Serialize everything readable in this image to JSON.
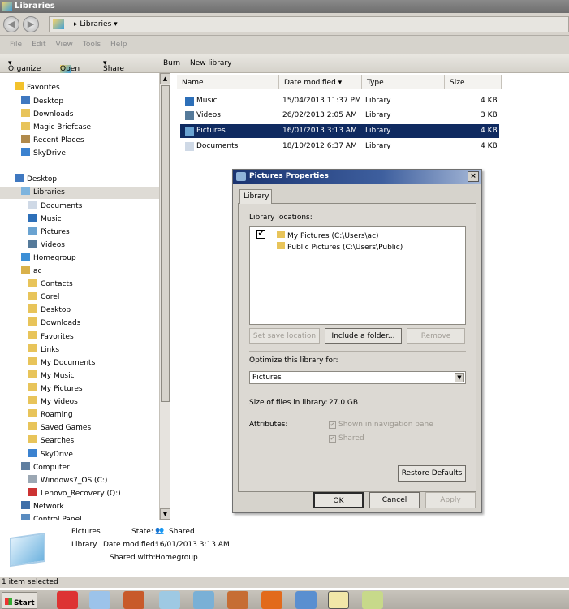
{
  "window": {
    "title": "Libraries"
  },
  "address": {
    "path": "Libraries"
  },
  "menu": [
    "File",
    "Edit",
    "View",
    "Tools",
    "Help"
  ],
  "toolbar": {
    "organize": "Organize",
    "open": "Open",
    "share_with": "Share with",
    "burn": "Burn",
    "new_library": "New library"
  },
  "nav": [
    {
      "label": "Favorites",
      "level": 0,
      "icon": "star-icon"
    },
    {
      "label": "Desktop",
      "level": 1,
      "icon": "desktop-icon"
    },
    {
      "label": "Downloads",
      "level": 1,
      "icon": "folder-icon"
    },
    {
      "label": "Magic Briefcase",
      "level": 1,
      "icon": "folder-icon"
    },
    {
      "label": "Recent Places",
      "level": 1,
      "icon": "recent-places-icon"
    },
    {
      "label": "SkyDrive",
      "level": 1,
      "icon": "skydrive-icon"
    },
    {
      "label": "Desktop",
      "level": 0,
      "icon": "desktop-icon"
    },
    {
      "label": "Libraries",
      "level": 1,
      "icon": "libraries-icon",
      "selected": true
    },
    {
      "label": "Documents",
      "level": 2,
      "icon": "documents-icon"
    },
    {
      "label": "Music",
      "level": 2,
      "icon": "music-icon"
    },
    {
      "label": "Pictures",
      "level": 2,
      "icon": "pictures-icon"
    },
    {
      "label": "Videos",
      "level": 2,
      "icon": "videos-icon"
    },
    {
      "label": "Homegroup",
      "level": 1,
      "icon": "homegroup-icon"
    },
    {
      "label": "ac",
      "level": 1,
      "icon": "user-folder-icon"
    },
    {
      "label": "Contacts",
      "level": 2,
      "icon": "folder-icon"
    },
    {
      "label": "Corel",
      "level": 2,
      "icon": "folder-icon"
    },
    {
      "label": "Desktop",
      "level": 2,
      "icon": "folder-icon"
    },
    {
      "label": "Downloads",
      "level": 2,
      "icon": "folder-icon"
    },
    {
      "label": "Favorites",
      "level": 2,
      "icon": "folder-icon"
    },
    {
      "label": "Links",
      "level": 2,
      "icon": "folder-icon"
    },
    {
      "label": "My Documents",
      "level": 2,
      "icon": "folder-icon"
    },
    {
      "label": "My Music",
      "level": 2,
      "icon": "folder-icon"
    },
    {
      "label": "My Pictures",
      "level": 2,
      "icon": "folder-icon"
    },
    {
      "label": "My Videos",
      "level": 2,
      "icon": "folder-icon"
    },
    {
      "label": "Roaming",
      "level": 2,
      "icon": "folder-icon"
    },
    {
      "label": "Saved Games",
      "level": 2,
      "icon": "folder-icon"
    },
    {
      "label": "Searches",
      "level": 2,
      "icon": "folder-icon"
    },
    {
      "label": "SkyDrive",
      "level": 2,
      "icon": "skydrive-icon"
    },
    {
      "label": "Computer",
      "level": 1,
      "icon": "computer-icon"
    },
    {
      "label": "Windows7_OS (C:)",
      "level": 2,
      "icon": "drive-icon"
    },
    {
      "label": "Lenovo_Recovery (Q:)",
      "level": 2,
      "icon": "recovery-drive-icon"
    },
    {
      "label": "Network",
      "level": 1,
      "icon": "network-icon"
    },
    {
      "label": "Control Panel",
      "level": 1,
      "icon": "control-panel-icon"
    }
  ],
  "list": {
    "columns": [
      "Name",
      "Date modified",
      "Type",
      "Size"
    ],
    "rows": [
      {
        "name": "Music",
        "date": "15/04/2013 11:37 PM",
        "type": "Library",
        "size": "4 KB"
      },
      {
        "name": "Videos",
        "date": "26/02/2013 2:05 AM",
        "type": "Library",
        "size": "3 KB"
      },
      {
        "name": "Pictures",
        "date": "16/01/2013 3:13 AM",
        "type": "Library",
        "size": "4 KB",
        "selected": true
      },
      {
        "name": "Documents",
        "date": "18/10/2012 6:37 AM",
        "type": "Library",
        "size": "4 KB"
      }
    ]
  },
  "dialog": {
    "title": "Pictures Properties",
    "close": "×",
    "tab": "Library",
    "locations_label": "Library locations:",
    "locations": [
      "My Pictures (C:\\Users\\ac)",
      "Public Pictures (C:\\Users\\Public)"
    ],
    "set_save": "Set save location",
    "include": "Include a folder...",
    "remove": "Remove",
    "optimize_label": "Optimize this library for:",
    "optimize_value": "Pictures",
    "size_label": "Size of files in library:",
    "size_value": "27.0 GB",
    "attributes_label": "Attributes:",
    "attr_nav": "Shown in navigation pane",
    "attr_shared": "Shared",
    "restore": "Restore Defaults",
    "ok": "OK",
    "cancel": "Cancel",
    "apply": "Apply"
  },
  "details": {
    "name": "Pictures",
    "type": "Library",
    "state_label": "State:",
    "state_value": "Shared",
    "date_label": "Date modified:",
    "date_value": "16/01/2013 3:13 AM",
    "shared_label": "Shared with:",
    "shared_value": "Homegroup"
  },
  "status": "1 item selected",
  "taskbar": {
    "start": "Start"
  }
}
